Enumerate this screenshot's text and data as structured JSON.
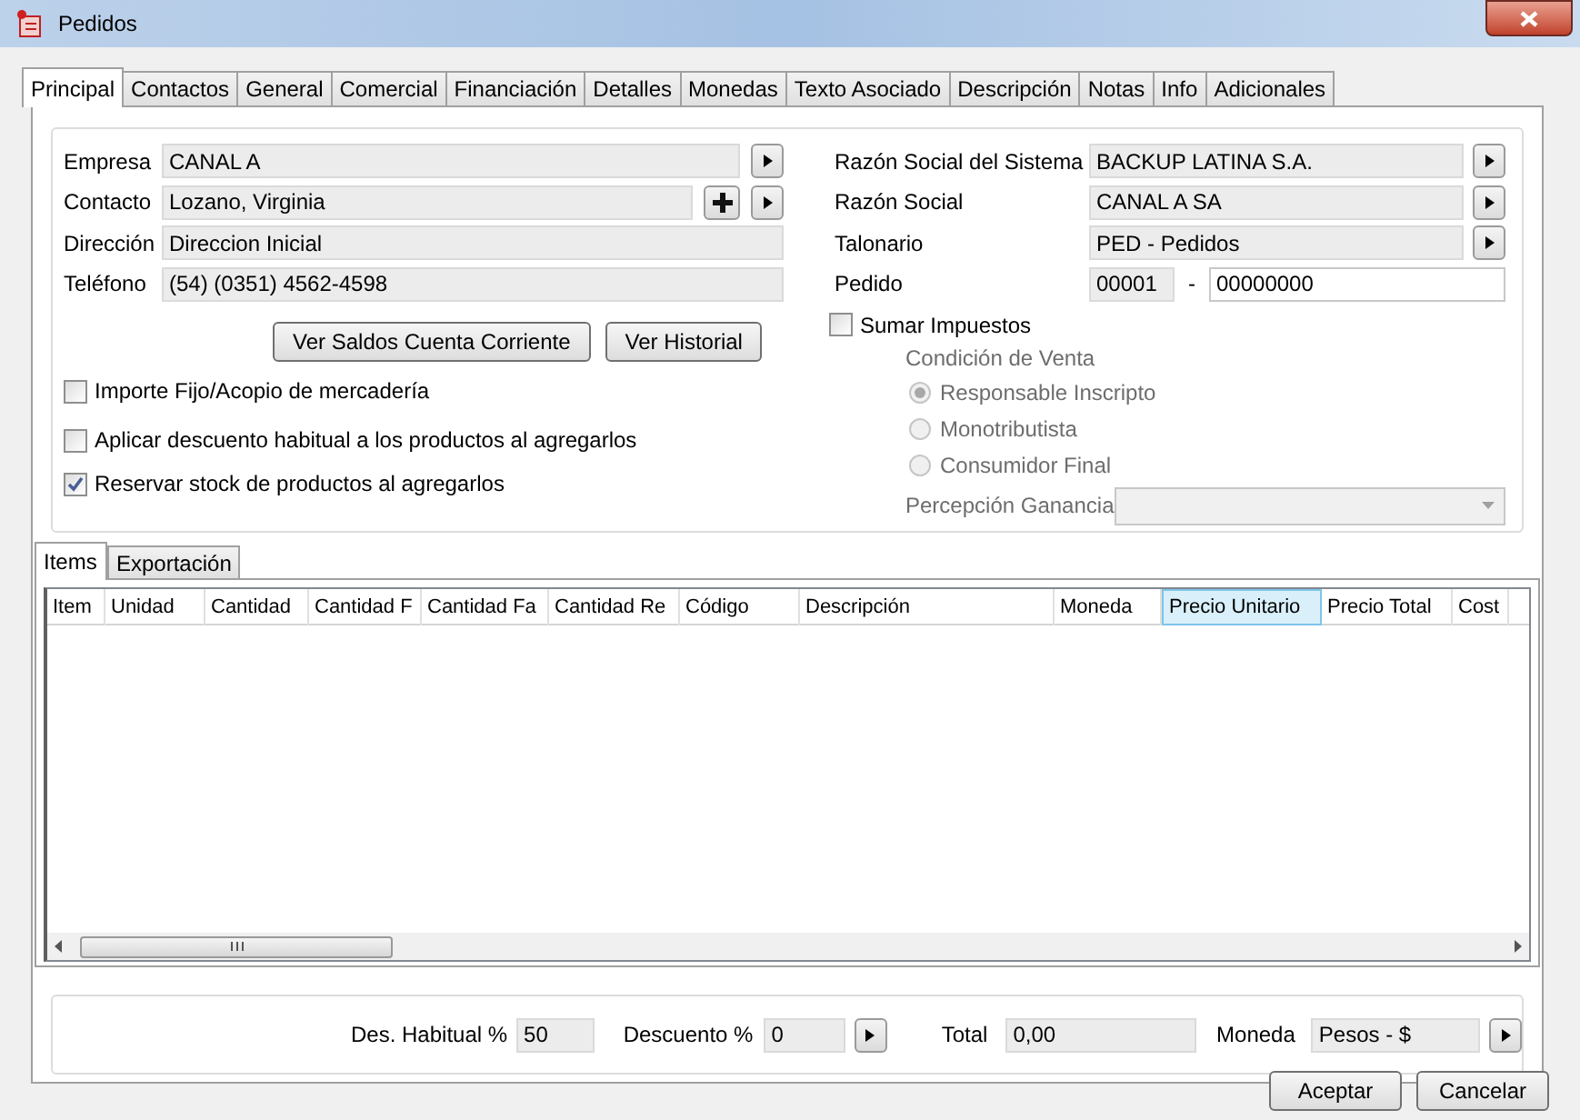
{
  "window": {
    "title": "Pedidos"
  },
  "tabs": [
    {
      "label": "Principal",
      "selected": true
    },
    {
      "label": "Contactos",
      "selected": false
    },
    {
      "label": "General",
      "selected": false
    },
    {
      "label": "Comercial",
      "selected": false
    },
    {
      "label": "Financiación",
      "selected": false
    },
    {
      "label": "Detalles",
      "selected": false
    },
    {
      "label": "Monedas",
      "selected": false
    },
    {
      "label": "Texto Asociado",
      "selected": false
    },
    {
      "label": "Descripción",
      "selected": false
    },
    {
      "label": "Notas",
      "selected": false
    },
    {
      "label": "Info",
      "selected": false
    },
    {
      "label": "Adicionales",
      "selected": false
    }
  ],
  "left_fields": [
    {
      "label": "Empresa",
      "value": "CANAL A",
      "readonly": true,
      "next_button": true
    },
    {
      "label": "Contacto",
      "value": "Lozano, Virginia",
      "readonly": true,
      "add_button": true,
      "next_button": true
    },
    {
      "label": "Dirección",
      "value": "Direccion Inicial",
      "readonly": true
    },
    {
      "label": "Teléfono",
      "value": "(54) (0351) 4562-4598",
      "readonly": true
    }
  ],
  "account_buttons": [
    "Ver Saldos Cuenta Corriente",
    "Ver Historial"
  ],
  "options": [
    {
      "label": "Importe Fijo/Acopio de mercadería",
      "checked": false
    },
    {
      "label": "Aplicar descuento habitual a los productos al agregarlos",
      "checked": false
    },
    {
      "label": "Reservar stock de productos al agregarlos",
      "checked": true
    }
  ],
  "right_fields": [
    {
      "label": "Razón Social del Sistema",
      "value": "BACKUP LATINA S.A.",
      "readonly": true,
      "next_button": true
    },
    {
      "label": "Razón Social",
      "value": "CANAL A SA",
      "readonly": true,
      "next_button": true
    },
    {
      "label": "Talonario",
      "value": "PED - Pedidos",
      "readonly": true,
      "next_button": true
    }
  ],
  "pedido": {
    "label": "Pedido",
    "prefix": "00001",
    "separator": "-",
    "number": "00000000"
  },
  "sumar_impuestos": {
    "label": "Sumar Impuestos",
    "checked": false
  },
  "condicion_venta": {
    "title": "Condición de Venta",
    "disabled": true,
    "options": [
      {
        "label": "Responsable Inscripto",
        "selected": true
      },
      {
        "label": "Monotributista",
        "selected": false
      },
      {
        "label": "Consumidor Final",
        "selected": false
      }
    ]
  },
  "percepcion": {
    "label": "Percepción Ganancia",
    "disabled": true
  },
  "item_tabs": [
    {
      "label": "Items",
      "selected": true
    },
    {
      "label": "Exportación",
      "selected": false
    }
  ],
  "table": {
    "columns": [
      {
        "label": "Item",
        "selected": false
      },
      {
        "label": "Unidad",
        "selected": false
      },
      {
        "label": "Cantidad",
        "selected": false
      },
      {
        "label": "Cantidad F",
        "selected": false
      },
      {
        "label": "Cantidad Fa",
        "selected": false
      },
      {
        "label": "Cantidad Re",
        "selected": false
      },
      {
        "label": "Código",
        "selected": false
      },
      {
        "label": "Descripción",
        "selected": false
      },
      {
        "label": "Moneda",
        "selected": false
      },
      {
        "label": "Precio Unitario",
        "selected": true
      },
      {
        "label": "Precio Total",
        "selected": false
      },
      {
        "label": "Cost",
        "selected": false
      }
    ]
  },
  "totals": [
    {
      "label": "Des. Habitual %",
      "value": "50"
    },
    {
      "label": "Descuento %",
      "value": "0",
      "next_button": true
    },
    {
      "label": "Total",
      "value": "0,00"
    },
    {
      "label": "Moneda",
      "value": "Pesos - $",
      "next_button": true
    }
  ],
  "dialog_buttons": [
    "Aceptar",
    "Cancelar"
  ]
}
